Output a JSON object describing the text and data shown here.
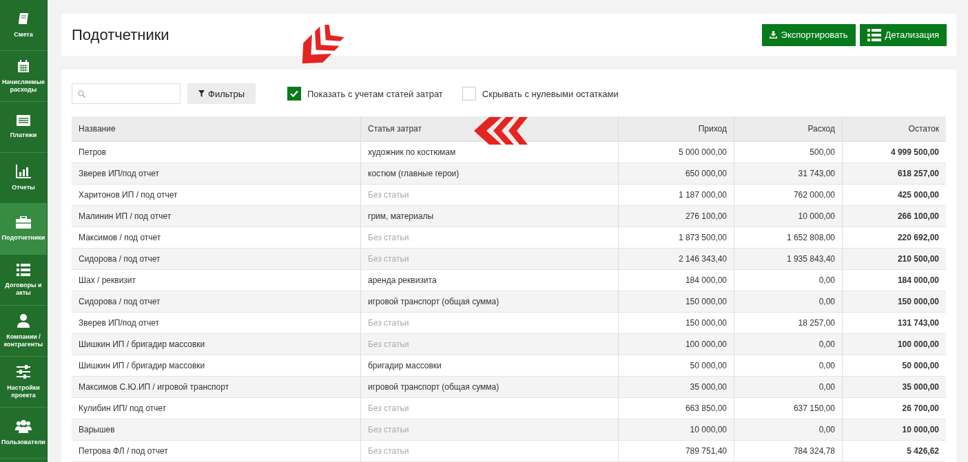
{
  "sidebar": {
    "items": [
      {
        "label": "Смета",
        "selected": false
      },
      {
        "label": "Начисляемые расходы",
        "selected": false
      },
      {
        "label": "Платежи",
        "selected": false
      },
      {
        "label": "Отчеты",
        "selected": false
      },
      {
        "label": "Подотчетники",
        "selected": true
      },
      {
        "label": "Договоры и акты",
        "selected": false
      },
      {
        "label": "Компании / контрагенты",
        "selected": false
      },
      {
        "label": "Настройки проекта",
        "selected": false
      },
      {
        "label": "Пользователи",
        "selected": false
      }
    ]
  },
  "header": {
    "title": "Подотчетники",
    "buttons": [
      {
        "label": "Экспортировать"
      },
      {
        "label": "Детализация"
      }
    ]
  },
  "toolbar": {
    "filter_button": "Фильтры",
    "options": [
      {
        "label": "Показать с учетам статей затрат",
        "checked": true
      },
      {
        "label": "Скрывать с нулевыми остатками",
        "checked": false
      }
    ]
  },
  "table": {
    "columns": [
      "Название",
      "Статья затрат",
      "Приход",
      "Расход",
      "Остаток"
    ],
    "rows": [
      {
        "name": "Петров",
        "article": "художник по костюмам",
        "article_muted": false,
        "income": "5 000 000,00",
        "expense": "500,00",
        "balance": "4 999 500,00"
      },
      {
        "name": "Зверев ИП/под отчет",
        "article": "костюм (главные герои)",
        "article_muted": false,
        "income": "650 000,00",
        "expense": "31 743,00",
        "balance": "618 257,00"
      },
      {
        "name": "Харитонов ИП / под отчет",
        "article": "Без статьи",
        "article_muted": true,
        "income": "1 187 000,00",
        "expense": "762 000,00",
        "balance": "425 000,00"
      },
      {
        "name": "Малинин ИП / под отчет",
        "article": "грим, материалы",
        "article_muted": false,
        "income": "276 100,00",
        "expense": "10 000,00",
        "balance": "266 100,00"
      },
      {
        "name": "Максимов / под отчет",
        "article": "Без статьи",
        "article_muted": true,
        "income": "1 873 500,00",
        "expense": "1 652 808,00",
        "balance": "220 692,00"
      },
      {
        "name": "Сидорова / под отчет",
        "article": "Без статьи",
        "article_muted": true,
        "income": "2 146 343,40",
        "expense": "1 935 843,40",
        "balance": "210 500,00"
      },
      {
        "name": "Шах / реквизит",
        "article": "аренда реквизита",
        "article_muted": false,
        "income": "184 000,00",
        "expense": "0,00",
        "balance": "184 000,00"
      },
      {
        "name": "Сидорова / под отчет",
        "article": "игровой транспорт (общая сумма)",
        "article_muted": false,
        "income": "150 000,00",
        "expense": "0,00",
        "balance": "150 000,00"
      },
      {
        "name": "Зверев ИП/под отчет",
        "article": "Без статьи",
        "article_muted": true,
        "income": "150 000,00",
        "expense": "18 257,00",
        "balance": "131 743,00"
      },
      {
        "name": "Шишкин ИП / бригадир массовки",
        "article": "Без статьи",
        "article_muted": true,
        "income": "100 000,00",
        "expense": "0,00",
        "balance": "100 000,00"
      },
      {
        "name": "Шишкин ИП / бригадир массовки",
        "article": "бригадир массовки",
        "article_muted": false,
        "income": "50 000,00",
        "expense": "0,00",
        "balance": "50 000,00"
      },
      {
        "name": "Максимов С.Ю.ИП / игровой транспорт",
        "article": "игровой транспорт (общая сумма)",
        "article_muted": false,
        "income": "35 000,00",
        "expense": "0,00",
        "balance": "35 000,00"
      },
      {
        "name": "Кулибин ИП/ под отчет",
        "article": "Без статьи",
        "article_muted": true,
        "income": "663 850,00",
        "expense": "637 150,00",
        "balance": "26 700,00"
      },
      {
        "name": "Варышев",
        "article": "Без статьи",
        "article_muted": true,
        "income": "10 000,00",
        "expense": "0,00",
        "balance": "10 000,00"
      },
      {
        "name": "Петрова ФЛ / под отчет",
        "article": "Без статьи",
        "article_muted": true,
        "income": "789 751,40",
        "expense": "784 324,78",
        "balance": "5 426,62"
      }
    ]
  }
}
